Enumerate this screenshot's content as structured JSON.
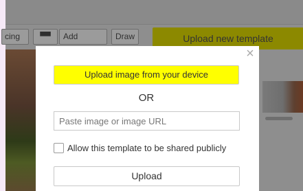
{
  "toolbar": {
    "spacing_label": "cing",
    "glasses_label": "▀▀",
    "add_image_label": "Add Image",
    "draw_label": "Draw",
    "upload_template_label": "Upload new template"
  },
  "modal": {
    "close_glyph": "×",
    "upload_device_label": "Upload image from your device",
    "or_text": "OR",
    "url_placeholder": "Paste image or image URL",
    "url_value": "",
    "share_checked": false,
    "share_label": "Allow this template to be shared publicly",
    "upload_label": "Upload"
  },
  "colors": {
    "highlight": "#ffff00",
    "overlay": "#8e8e8e"
  }
}
